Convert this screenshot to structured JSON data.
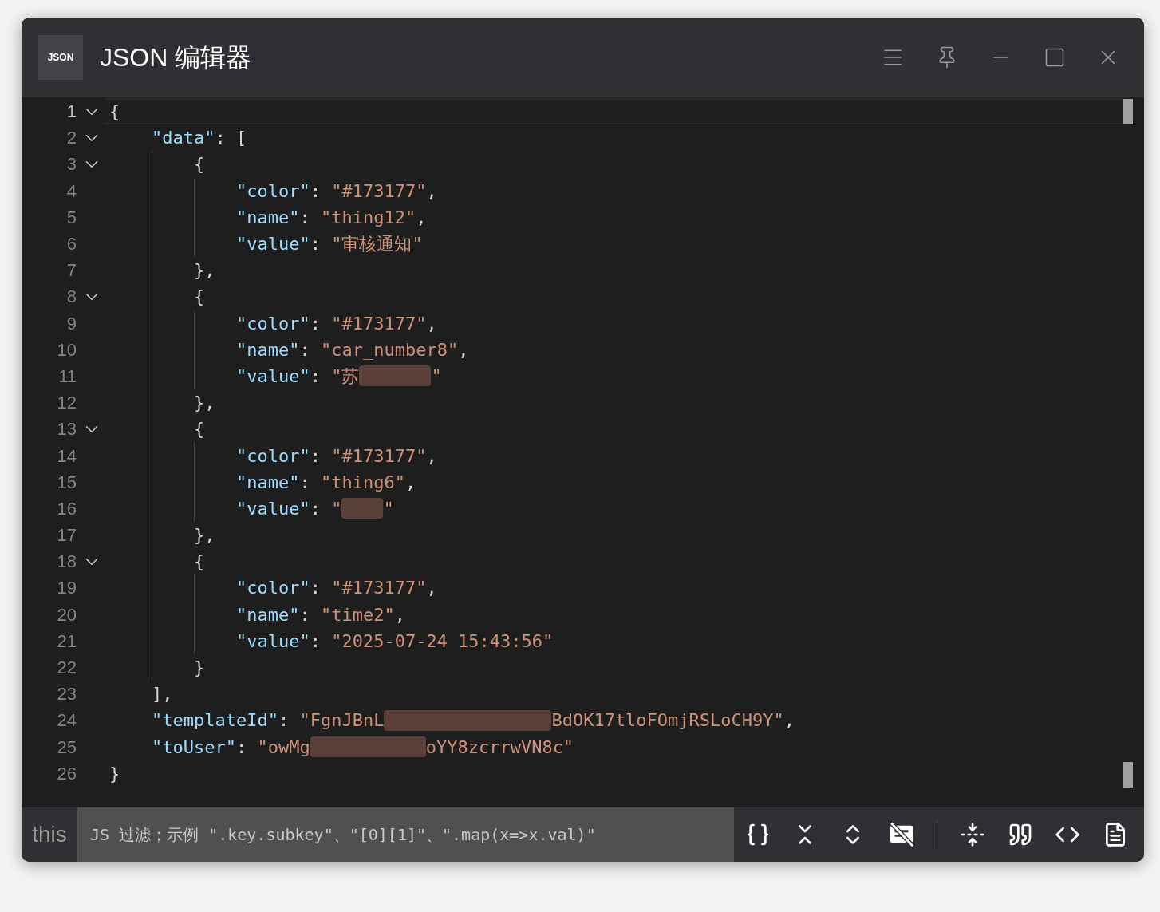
{
  "window": {
    "logo": "JSON",
    "title": "JSON 编辑器"
  },
  "editor": {
    "lines": [
      {
        "number": "1",
        "foldable": true,
        "current": true,
        "segments": [
          {
            "kind": "punct",
            "text": "{"
          }
        ]
      },
      {
        "number": "2",
        "foldable": true,
        "current": false,
        "segments": [
          {
            "kind": "key",
            "text": "    \"data\""
          },
          {
            "kind": "punct",
            "text": ": ["
          }
        ]
      },
      {
        "number": "3",
        "foldable": true,
        "current": false,
        "segments": [
          {
            "kind": "punct",
            "text": "        {"
          }
        ]
      },
      {
        "number": "4",
        "foldable": false,
        "current": false,
        "segments": [
          {
            "kind": "key",
            "text": "            \"color\""
          },
          {
            "kind": "punct",
            "text": ": "
          },
          {
            "kind": "string",
            "text": "\"#173177\""
          },
          {
            "kind": "punct",
            "text": ","
          }
        ]
      },
      {
        "number": "5",
        "foldable": false,
        "current": false,
        "segments": [
          {
            "kind": "key",
            "text": "            \"name\""
          },
          {
            "kind": "punct",
            "text": ": "
          },
          {
            "kind": "string",
            "text": "\"thing12\""
          },
          {
            "kind": "punct",
            "text": ","
          }
        ]
      },
      {
        "number": "6",
        "foldable": false,
        "current": false,
        "segments": [
          {
            "kind": "key",
            "text": "            \"value\""
          },
          {
            "kind": "punct",
            "text": ": "
          },
          {
            "kind": "string",
            "text": "\"审核通知\""
          }
        ]
      },
      {
        "number": "7",
        "foldable": false,
        "current": false,
        "segments": [
          {
            "kind": "punct",
            "text": "        },"
          }
        ]
      },
      {
        "number": "8",
        "foldable": true,
        "current": false,
        "segments": [
          {
            "kind": "punct",
            "text": "        {"
          }
        ]
      },
      {
        "number": "9",
        "foldable": false,
        "current": false,
        "segments": [
          {
            "kind": "key",
            "text": "            \"color\""
          },
          {
            "kind": "punct",
            "text": ": "
          },
          {
            "kind": "string",
            "text": "\"#173177\""
          },
          {
            "kind": "punct",
            "text": ","
          }
        ]
      },
      {
        "number": "10",
        "foldable": false,
        "current": false,
        "segments": [
          {
            "kind": "key",
            "text": "            \"name\""
          },
          {
            "kind": "punct",
            "text": ": "
          },
          {
            "kind": "string",
            "text": "\"car_number8\""
          },
          {
            "kind": "punct",
            "text": ","
          }
        ]
      },
      {
        "number": "11",
        "foldable": false,
        "current": false,
        "segments": [
          {
            "kind": "key",
            "text": "            \"value\""
          },
          {
            "kind": "punct",
            "text": ": "
          },
          {
            "kind": "string",
            "text": "\"苏"
          },
          {
            "kind": "redacted"
          },
          {
            "kind": "string",
            "text": "\""
          }
        ]
      },
      {
        "number": "12",
        "foldable": false,
        "current": false,
        "segments": [
          {
            "kind": "punct",
            "text": "        },"
          }
        ]
      },
      {
        "number": "13",
        "foldable": true,
        "current": false,
        "segments": [
          {
            "kind": "punct",
            "text": "        {"
          }
        ]
      },
      {
        "number": "14",
        "foldable": false,
        "current": false,
        "segments": [
          {
            "kind": "key",
            "text": "            \"color\""
          },
          {
            "kind": "punct",
            "text": ": "
          },
          {
            "kind": "string",
            "text": "\"#173177\""
          },
          {
            "kind": "punct",
            "text": ","
          }
        ]
      },
      {
        "number": "15",
        "foldable": false,
        "current": false,
        "segments": [
          {
            "kind": "key",
            "text": "            \"name\""
          },
          {
            "kind": "punct",
            "text": ": "
          },
          {
            "kind": "string",
            "text": "\"thing6\""
          },
          {
            "kind": "punct",
            "text": ","
          }
        ]
      },
      {
        "number": "16",
        "foldable": false,
        "current": false,
        "segments": [
          {
            "kind": "key",
            "text": "            \"value\""
          },
          {
            "kind": "punct",
            "text": ": "
          },
          {
            "kind": "string",
            "text": "\""
          },
          {
            "kind": "redacted"
          },
          {
            "kind": "string",
            "text": "\""
          }
        ]
      },
      {
        "number": "17",
        "foldable": false,
        "current": false,
        "segments": [
          {
            "kind": "punct",
            "text": "        },"
          }
        ]
      },
      {
        "number": "18",
        "foldable": true,
        "current": false,
        "segments": [
          {
            "kind": "punct",
            "text": "        {"
          }
        ]
      },
      {
        "number": "19",
        "foldable": false,
        "current": false,
        "segments": [
          {
            "kind": "key",
            "text": "            \"color\""
          },
          {
            "kind": "punct",
            "text": ": "
          },
          {
            "kind": "string",
            "text": "\"#173177\""
          },
          {
            "kind": "punct",
            "text": ","
          }
        ]
      },
      {
        "number": "20",
        "foldable": false,
        "current": false,
        "segments": [
          {
            "kind": "key",
            "text": "            \"name\""
          },
          {
            "kind": "punct",
            "text": ": "
          },
          {
            "kind": "string",
            "text": "\"time2\""
          },
          {
            "kind": "punct",
            "text": ","
          }
        ]
      },
      {
        "number": "21",
        "foldable": false,
        "current": false,
        "segments": [
          {
            "kind": "key",
            "text": "            \"value\""
          },
          {
            "kind": "punct",
            "text": ": "
          },
          {
            "kind": "string",
            "text": "\"2025-07-24 15:43:56\""
          }
        ]
      },
      {
        "number": "22",
        "foldable": false,
        "current": false,
        "segments": [
          {
            "kind": "punct",
            "text": "        }"
          }
        ]
      },
      {
        "number": "23",
        "foldable": false,
        "current": false,
        "segments": [
          {
            "kind": "punct",
            "text": "    ],"
          }
        ]
      },
      {
        "number": "24",
        "foldable": false,
        "current": false,
        "segments": [
          {
            "kind": "key",
            "text": "    \"templateId\""
          },
          {
            "kind": "punct",
            "text": ": "
          },
          {
            "kind": "string",
            "text": "\"FgnJBnL"
          },
          {
            "kind": "redacted"
          },
          {
            "kind": "string",
            "text": "BdOK17tloFOmjRSLoCH9Y\""
          },
          {
            "kind": "punct",
            "text": ","
          }
        ]
      },
      {
        "number": "25",
        "foldable": false,
        "current": false,
        "segments": [
          {
            "kind": "key",
            "text": "    \"toUser\""
          },
          {
            "kind": "punct",
            "text": ": "
          },
          {
            "kind": "string",
            "text": "\"owMg"
          },
          {
            "kind": "redacted"
          },
          {
            "kind": "string",
            "text": "oYY8zcrrwVN8c\""
          }
        ]
      },
      {
        "number": "26",
        "foldable": false,
        "current": false,
        "segments": [
          {
            "kind": "punct",
            "text": "}"
          }
        ]
      }
    ]
  },
  "filter_bar": {
    "label": "this",
    "placeholder": "JS 过滤；示例 \".key.subkey\"、\"[0][1]\"、\".map(x=>x.val)\""
  }
}
